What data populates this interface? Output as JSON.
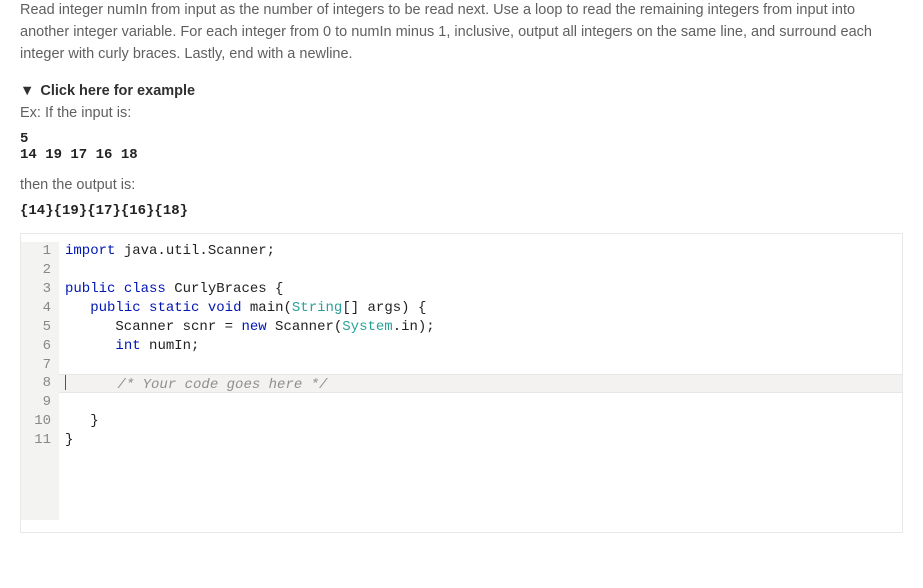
{
  "problem": {
    "description": "Read integer numIn from input as the number of integers to be read next. Use a loop to read the remaining integers from input into another integer variable. For each integer from 0 to numIn minus 1, inclusive, output all integers on the same line, and surround each integer with curly braces. Lastly, end with a newline.",
    "example_toggle": "Click here for example",
    "if_input_label": "Ex: If the input is:",
    "input_block": "5\n14 19 17 16 18",
    "then_output_label": "then the output is:",
    "output_block": "{14}{19}{17}{16}{18}"
  },
  "editor": {
    "line_count": 11,
    "tokens": [
      [
        {
          "t": "kw",
          "v": "import"
        },
        {
          "t": "",
          "v": " java.util.Scanner;"
        }
      ],
      [],
      [
        {
          "t": "kw",
          "v": "public"
        },
        {
          "t": "",
          "v": " "
        },
        {
          "t": "kw",
          "v": "class"
        },
        {
          "t": "",
          "v": " CurlyBraces {"
        }
      ],
      [
        {
          "t": "",
          "v": "   "
        },
        {
          "t": "kw",
          "v": "public"
        },
        {
          "t": "",
          "v": " "
        },
        {
          "t": "kw",
          "v": "static"
        },
        {
          "t": "",
          "v": " "
        },
        {
          "t": "kw",
          "v": "void"
        },
        {
          "t": "",
          "v": " main("
        },
        {
          "t": "typ",
          "v": "String"
        },
        {
          "t": "",
          "v": "[] args) {"
        }
      ],
      [
        {
          "t": "",
          "v": "      Scanner scnr = "
        },
        {
          "t": "kw",
          "v": "new"
        },
        {
          "t": "",
          "v": " Scanner("
        },
        {
          "t": "typ",
          "v": "System"
        },
        {
          "t": "",
          "v": ".in);"
        }
      ],
      [
        {
          "t": "",
          "v": "      "
        },
        {
          "t": "kw",
          "v": "int"
        },
        {
          "t": "",
          "v": " numIn;"
        }
      ],
      [],
      [
        {
          "t": "cursor",
          "v": ""
        },
        {
          "t": "",
          "v": "      "
        },
        {
          "t": "cmt",
          "v": "/* Your code goes here */"
        }
      ],
      [],
      [
        {
          "t": "",
          "v": "   }"
        }
      ],
      [
        {
          "t": "",
          "v": "}"
        }
      ]
    ],
    "highlighted_line": 8
  }
}
